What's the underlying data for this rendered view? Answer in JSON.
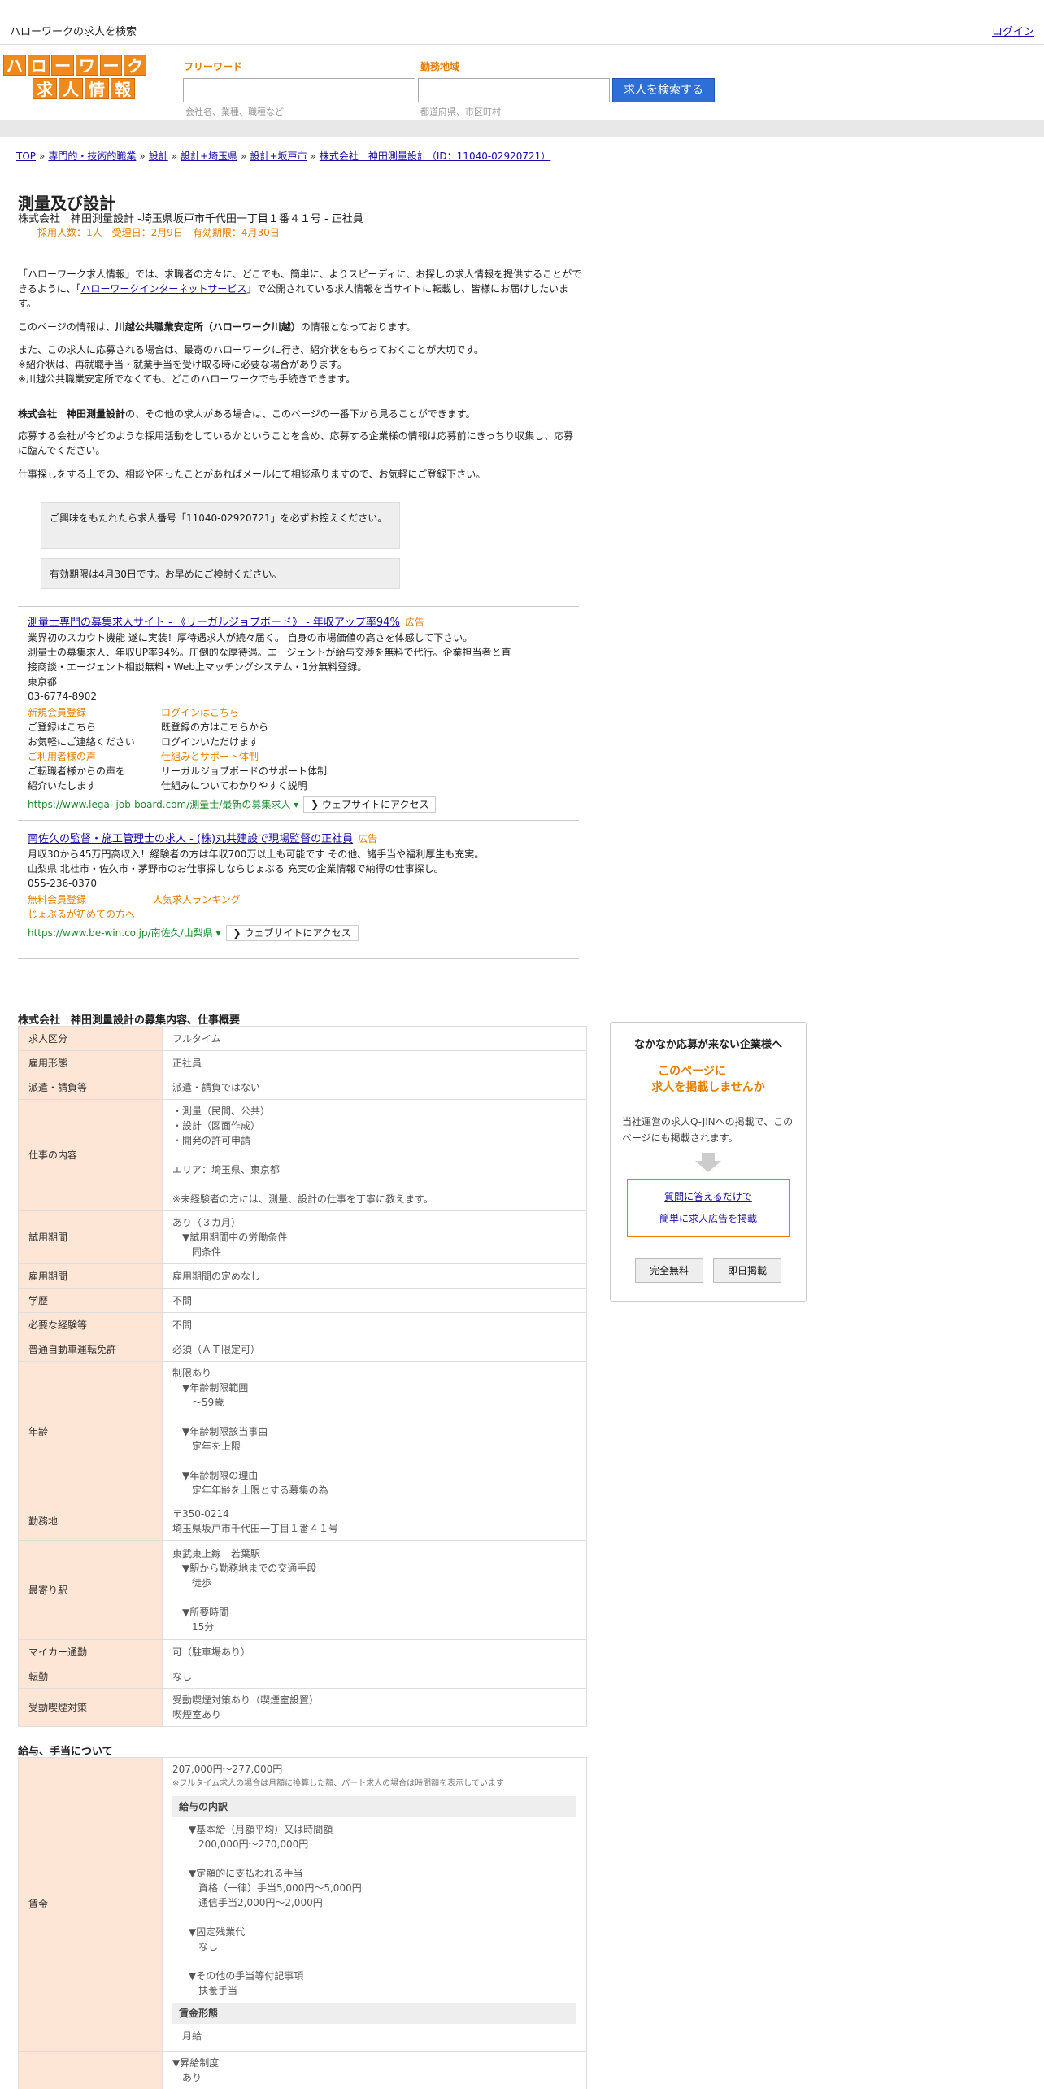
{
  "topbar": {
    "title": "ハローワークの求人を検索",
    "login": "ログイン"
  },
  "header": {
    "logo_row1": [
      "ハ",
      "ロ",
      "ー",
      "ワ",
      "ー",
      "ク"
    ],
    "logo_row2": [
      "求",
      "人",
      "情",
      "報"
    ],
    "freeword_label": "フリーワード",
    "freeword_placeholder": "会社名、業種、職種など",
    "area_label": "勤務地域",
    "area_placeholder": "都道府県、市区町村",
    "search_button": "求人を検索する"
  },
  "breadcrumb": [
    "TOP",
    "専門的・技術的職業",
    "設計",
    "設計+埼玉県",
    "設計+坂戸市",
    "株式会社　神田測量設計（ID：11040-02920721）"
  ],
  "job": {
    "title": "測量及び設計",
    "subtitle": "株式会社　神田測量設計 -埼玉県坂戸市千代田一丁目１番４１号 - 正社員",
    "meta": "採用人数：1人　受理日：2月9日　有効期限：4月30日"
  },
  "intro": {
    "p1_a": "「ハローワーク求人情報」では、求職者の方々に、どこでも、簡単に、よりスピーディに、お探しの求人情報を提供することができるように、「",
    "p1_link": "ハローワークインターネットサービス",
    "p1_b": "」で公開されている求人情報を当サイトに転載し、皆様にお届けしたいます。",
    "p2_a": "このページの情報は、",
    "p2_bold": "川越公共職業安定所（ハローワーク川越）",
    "p2_b": "の情報となっております。",
    "p3_l1": "また、この求人に応募される場合は、最寄のハローワークに行き、紹介状をもらっておくことが大切です。",
    "p3_l2": "※紹介状は、再就職手当・就業手当を受け取る時に必要な場合があります。",
    "p3_l3": "※川越公共職業安定所でなくても、どこのハローワークでも手続きできます。",
    "p4_bold": "株式会社　神田測量設計",
    "p4_b": "の、その他の求人がある場合は、このページの一番下から見ることができます。",
    "p5": "応募する会社が今どのような採用活動をしているかということを含め、応募する企業様の情報は応募前にきっちり収集し、応募に臨んでください。",
    "p6": "仕事探しをする上での、相談や困ったことがあればメールにて相談承りますので、お気軽にご登録下さい。"
  },
  "notices": {
    "n1": "ご興味をもたれたら求人番号「11040-02920721」を必ずお控えください。",
    "n2": "有効期限は4月30日です。お早めにご検討ください。"
  },
  "ads": [
    {
      "title": "測量士専門の募集求人サイト - 《リーガルジョブボード》 - 年収アップ率94%",
      "badge": "広告",
      "desc1": "業界初のスカウト機能 遂に実装！厚待遇求人が続々届く。 自身の市場価値の高さを体感して下さい。",
      "desc2": "測量士の募集求人、年収UP率94%。圧倒的な厚待遇。エージェントが給与交渉を無料で代行。企業担当者と直接商談・エージェント相談無料・Web上マッチングシステム・1分無料登録。",
      "location": "東京都",
      "phone": "03-6774-8902",
      "sitelinks": [
        {
          "title": "新規会員登録",
          "l1": "ご登録はこちら",
          "l2": "お気軽にご連絡ください"
        },
        {
          "title": "ログインはこちら",
          "l1": "既登録の方はこちらから",
          "l2": "ログインいただけます"
        },
        {
          "title": "ご利用者様の声",
          "l1": "ご転職者様からの声を",
          "l2": "紹介いたします"
        },
        {
          "title": "仕組みとサポート体制",
          "l1": "リーガルジョブボードのサポート体制",
          "l2": "仕組みについてわかりやすく説明"
        }
      ],
      "url": "https://www.legal-job-board.com/測量士/最新の募集求人",
      "visit": "ウェブサイトにアクセス"
    },
    {
      "title": "南佐久の監督・施工管理士の求人 - (株)丸共建設で現場監督の正社員",
      "badge": "広告",
      "desc1": "月収30から45万円高収入！経験者の方は年収700万以上も可能です その他、諸手当や福利厚生も充実。",
      "desc2": "山梨県 北杜市・佐久市・茅野市のお仕事探しならじょぶる 充実の企業情報で納得の仕事探し。",
      "phone": "055-236-0370",
      "sitelinks": [
        {
          "title": "無料会員登録"
        },
        {
          "title": "人気求人ランキング"
        },
        {
          "title": "じょぶるが初めての方へ"
        }
      ],
      "url": "https://www.be-win.co.jp/南佐久/山梨県",
      "visit": "ウェブサイトにアクセス"
    }
  ],
  "details": {
    "heading": "株式会社　神田測量設計の募集内容、仕事概要",
    "rows": [
      {
        "label": "求人区分",
        "value": "フルタイム"
      },
      {
        "label": "雇用形態",
        "value": "正社員"
      },
      {
        "label": "派遣・請負等",
        "value": "派遣・請負ではない"
      },
      {
        "label": "仕事の内容",
        "value": "・測量（民間、公共）\n・設計（図面作成）\n・開発の許可申請\n\nエリア：埼玉県、東京都\n\n※未経験者の方には、測量、設計の仕事を丁寧に教えます。"
      },
      {
        "label": "試用期間",
        "value": "あり（３カ月）\n　▼試用期間中の労働条件\n　　同条件"
      },
      {
        "label": "雇用期間",
        "value": "雇用期間の定めなし"
      },
      {
        "label": "学歴",
        "value": "不問"
      },
      {
        "label": "必要な経験等",
        "value": "不問"
      },
      {
        "label": "普通自動車運転免許",
        "value": "必須（ＡＴ限定可）"
      },
      {
        "label": "年齢",
        "value": "制限あり\n　▼年齢制限範囲\n　　〜59歳\n\n　▼年齢制限該当事由\n　　定年を上限\n\n　▼年齢制限の理由\n　　定年年齢を上限とする募集の為"
      },
      {
        "label": "勤務地",
        "value": "〒350-0214\n埼玉県坂戸市千代田一丁目１番４１号"
      },
      {
        "label": "最寄り駅",
        "value": "東武東上線　若葉駅\n　▼駅から勤務地までの交通手段\n　　徒歩\n\n　▼所要時間\n　　15分"
      },
      {
        "label": "マイカー通勤",
        "value": "可（駐車場あり）"
      },
      {
        "label": "転勤",
        "value": "なし"
      },
      {
        "label": "受動喫煙対策",
        "value": "受動喫煙対策あり（喫煙室設置）\n喫煙室あり"
      }
    ]
  },
  "salary": {
    "heading": "給与、手当について",
    "label": "賃金",
    "amount": "207,000円〜277,000円",
    "note": "※フルタイム求人の場合は月額に換算した額、パート求人の場合は時間額を表示しています",
    "breakdown_title": "給与の内訳",
    "breakdown": "▼基本給（月額平均）又は時間額\n　200,000円〜270,000円\n\n▼定額的に支払われる手当\n　資格（一律）手当5,000円〜5,000円\n　通信手当2,000円〜2,000円\n\n▼固定残業代\n　なし\n\n▼その他の手当等付記事項\n　扶養手当",
    "form_title": "賃金形態",
    "form": "月給",
    "raise": "▼昇給制度\n　あり"
  },
  "sidebox": {
    "title": "なかなか応募が来ない企業様へ",
    "accent1": "このページに",
    "accent2": "求人を掲載しませんか",
    "desc": "当社運営の求人Q-JiNへの掲載で、このページにも掲載されます。",
    "link1": "質問に答えるだけで",
    "link2": "簡単に求人広告を掲載",
    "btn1": "完全無料",
    "btn2": "即日掲載"
  }
}
